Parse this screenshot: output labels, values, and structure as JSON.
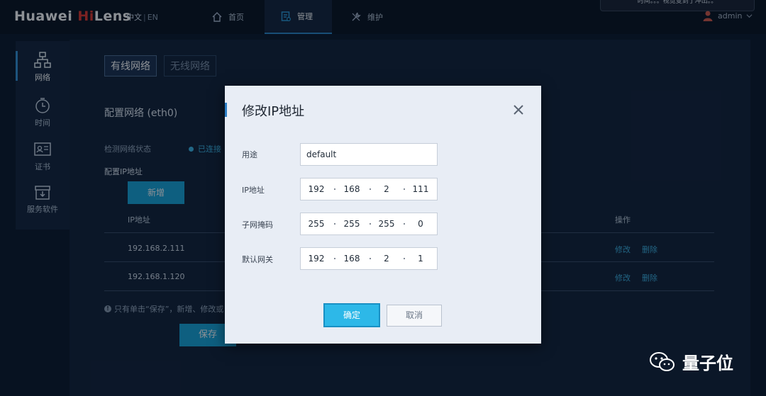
{
  "app": {
    "brand_prefix": "Huawei ",
    "brand_hi": "Hi",
    "brand_suffix": "Lens"
  },
  "lang": {
    "zh": "中文",
    "sep": "|",
    "en": "EN"
  },
  "nav": {
    "home": "首页",
    "manage": "管理",
    "maintain": "维护"
  },
  "toast": "时间。。。视觉变到了冲出。。",
  "user": {
    "name": "admin"
  },
  "sidebar": {
    "items": [
      {
        "label": "网络",
        "icon": "network-icon"
      },
      {
        "label": "时间",
        "icon": "clock-icon"
      },
      {
        "label": "证书",
        "icon": "certificate-icon"
      },
      {
        "label": "服务软件",
        "icon": "software-package-icon"
      }
    ]
  },
  "tabs": {
    "wired": "有线网络",
    "wireless": "无线网络"
  },
  "section": {
    "title": "配置网络 (eth0)",
    "status_label": "检测网络状态",
    "status_value": "已连接",
    "ip_label": "配置IP地址",
    "add_button": "新增"
  },
  "table": {
    "headers": {
      "ip": "IP地址",
      "ops": "操作"
    },
    "rows": [
      {
        "ip": "192.168.2.111",
        "edit": "修改",
        "delete": "删除"
      },
      {
        "ip": "192.168.1.120",
        "edit": "修改",
        "delete": "删除"
      }
    ]
  },
  "note": "只有单击“保存”，新增、修改或",
  "save_button": "保存",
  "modal": {
    "title": "修改IP地址",
    "purpose_label": "用途",
    "purpose_value": "default",
    "ip_label": "IP地址",
    "ip": [
      "192",
      "168",
      "2",
      "111"
    ],
    "mask_label": "子网掩码",
    "mask": [
      "255",
      "255",
      "255",
      "0"
    ],
    "gateway_label": "默认网关",
    "gateway": [
      "192",
      "168",
      "2",
      "1"
    ],
    "ok": "确定",
    "cancel": "取消"
  },
  "watermark": "量子位",
  "colors": {
    "accent": "#1aa6d9",
    "brand_red": "#e0382f",
    "link": "#3fb1e0"
  }
}
